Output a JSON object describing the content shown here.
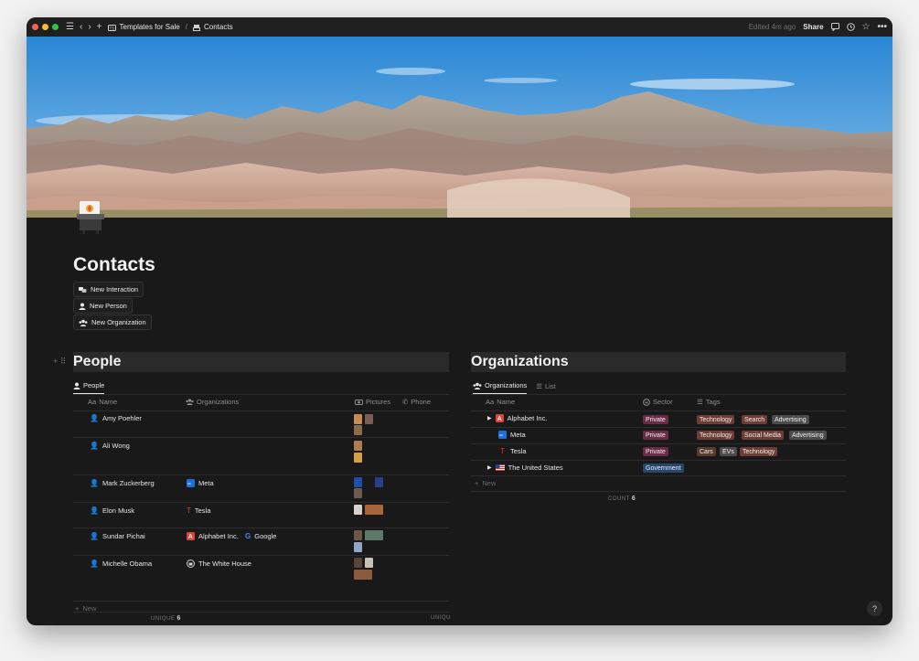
{
  "topbar": {
    "breadcrumbs": [
      {
        "label": "Templates for Sale",
        "icon": "templates-icon"
      },
      {
        "label": "Contacts",
        "icon": "contacts-icon"
      }
    ],
    "separator": "/",
    "edited": "Edited 4m ago",
    "share": "Share"
  },
  "page": {
    "title": "Contacts",
    "buttons": [
      {
        "label": "New Interaction",
        "icon": "interaction-icon"
      },
      {
        "label": "New Person",
        "icon": "person-icon"
      },
      {
        "label": "New Organization",
        "icon": "organization-icon"
      }
    ]
  },
  "people": {
    "heading": "People",
    "view_tab": "People",
    "columns": {
      "name": "Name",
      "organizations": "Organizations",
      "pictures": "Pictures",
      "phone": "Phone"
    },
    "name_prefix": "Aa",
    "rows": [
      {
        "name": "Amy Poehler",
        "orgs": [],
        "pictures": 3
      },
      {
        "name": "Ali Wong",
        "orgs": [],
        "pictures": 2
      },
      {
        "name": "Mark Zuckerberg",
        "orgs": [
          {
            "label": "Meta",
            "icon": "meta-icon"
          }
        ],
        "pictures": 3
      },
      {
        "name": "Elon Musk",
        "orgs": [
          {
            "label": "Tesla",
            "icon": "tesla-icon"
          }
        ],
        "pictures": 2
      },
      {
        "name": "Sundar Pichai",
        "orgs": [
          {
            "label": "Alphabet Inc.",
            "icon": "alphabet-icon"
          },
          {
            "label": "Google",
            "icon": "google-icon"
          }
        ],
        "pictures": 3
      },
      {
        "name": "Michelle Obama",
        "orgs": [
          {
            "label": "The White House",
            "icon": "whitehouse-icon"
          }
        ],
        "pictures": 3
      }
    ],
    "new_label": "New",
    "footer_label": "UNIQUE",
    "footer_value": "6",
    "footer_label_2": "UNIQU"
  },
  "organizations": {
    "heading": "Organizations",
    "tabs": [
      {
        "label": "Organizations",
        "icon": "organization-icon",
        "active": true
      },
      {
        "label": "List",
        "icon": "list-icon",
        "active": false
      }
    ],
    "columns": {
      "name": "Name",
      "sector": "Sector",
      "tags": "Tags"
    },
    "name_prefix": "Aa",
    "rows": [
      {
        "name": "Alphabet Inc.",
        "expandable": true,
        "icon": "alphabet-icon",
        "sector": "Private",
        "tags": [
          "Technology",
          "Search",
          "Advertising"
        ]
      },
      {
        "name": "Meta",
        "expandable": false,
        "icon": "meta-icon",
        "sector": "Private",
        "tags": [
          "Technology",
          "Social Media",
          "Advertising"
        ]
      },
      {
        "name": "Tesla",
        "expandable": false,
        "icon": "tesla-icon",
        "sector": "Private",
        "tags": [
          "Cars",
          "EVs",
          "Technology"
        ]
      },
      {
        "name": "The United States",
        "expandable": true,
        "icon": "us-flag-icon",
        "sector": "Government",
        "tags": []
      }
    ],
    "new_label": "New",
    "footer_label": "COUNT",
    "footer_value": "6"
  },
  "colors": {
    "background": "#191919",
    "private_sector": "#6b2a46",
    "government_sector": "#28456c",
    "technology_tag": "#6e3b35",
    "advertising_tag": "#4b4b4b",
    "cars_tag": "#5a3a2a",
    "evs_tag": "#4b4b4b",
    "person_icon": "#4a90d9"
  },
  "help": "?"
}
